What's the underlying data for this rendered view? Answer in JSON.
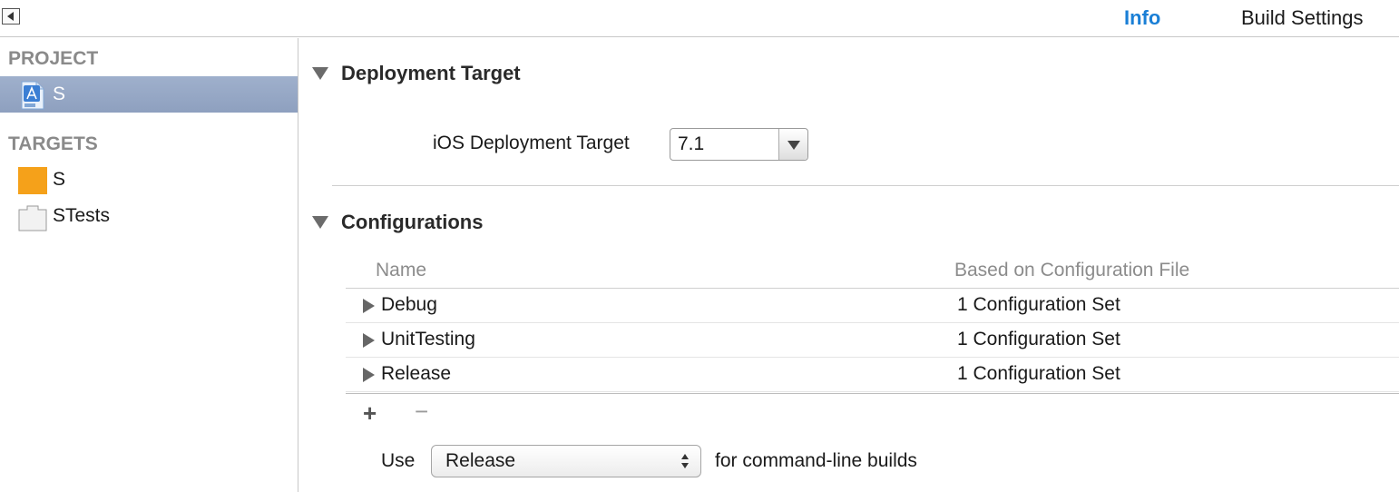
{
  "topbar": {
    "tabs": [
      {
        "label": "Info"
      },
      {
        "label": "Build Settings"
      }
    ]
  },
  "sidebar": {
    "project_header": "PROJECT",
    "project_items": [
      {
        "label": "S"
      }
    ],
    "targets_header": "TARGETS",
    "target_items": [
      {
        "label": "S"
      },
      {
        "label": "STests"
      }
    ]
  },
  "deployment": {
    "title": "Deployment Target",
    "ios_label": "iOS Deployment Target",
    "ios_value": "7.1"
  },
  "configurations": {
    "title": "Configurations",
    "col_name": "Name",
    "col_based": "Based on Configuration File",
    "rows": [
      {
        "name": "Debug",
        "based": "1 Configuration Set"
      },
      {
        "name": "UnitTesting",
        "based": "1 Configuration Set"
      },
      {
        "name": "Release",
        "based": "1 Configuration Set"
      }
    ],
    "add_label": "+",
    "remove_label": "−",
    "use_label": "Use",
    "use_value": "Release",
    "cmd_label": "for command-line builds"
  },
  "colors": {
    "accent": "#1a7fd6",
    "selection": "#8ea0bf",
    "target_icon": "#f5a11a"
  },
  "icons": {
    "back": "back-arrow-icon",
    "project": "xcode-project-icon",
    "app_target": "app-target-icon",
    "test_target": "test-bundle-icon"
  }
}
